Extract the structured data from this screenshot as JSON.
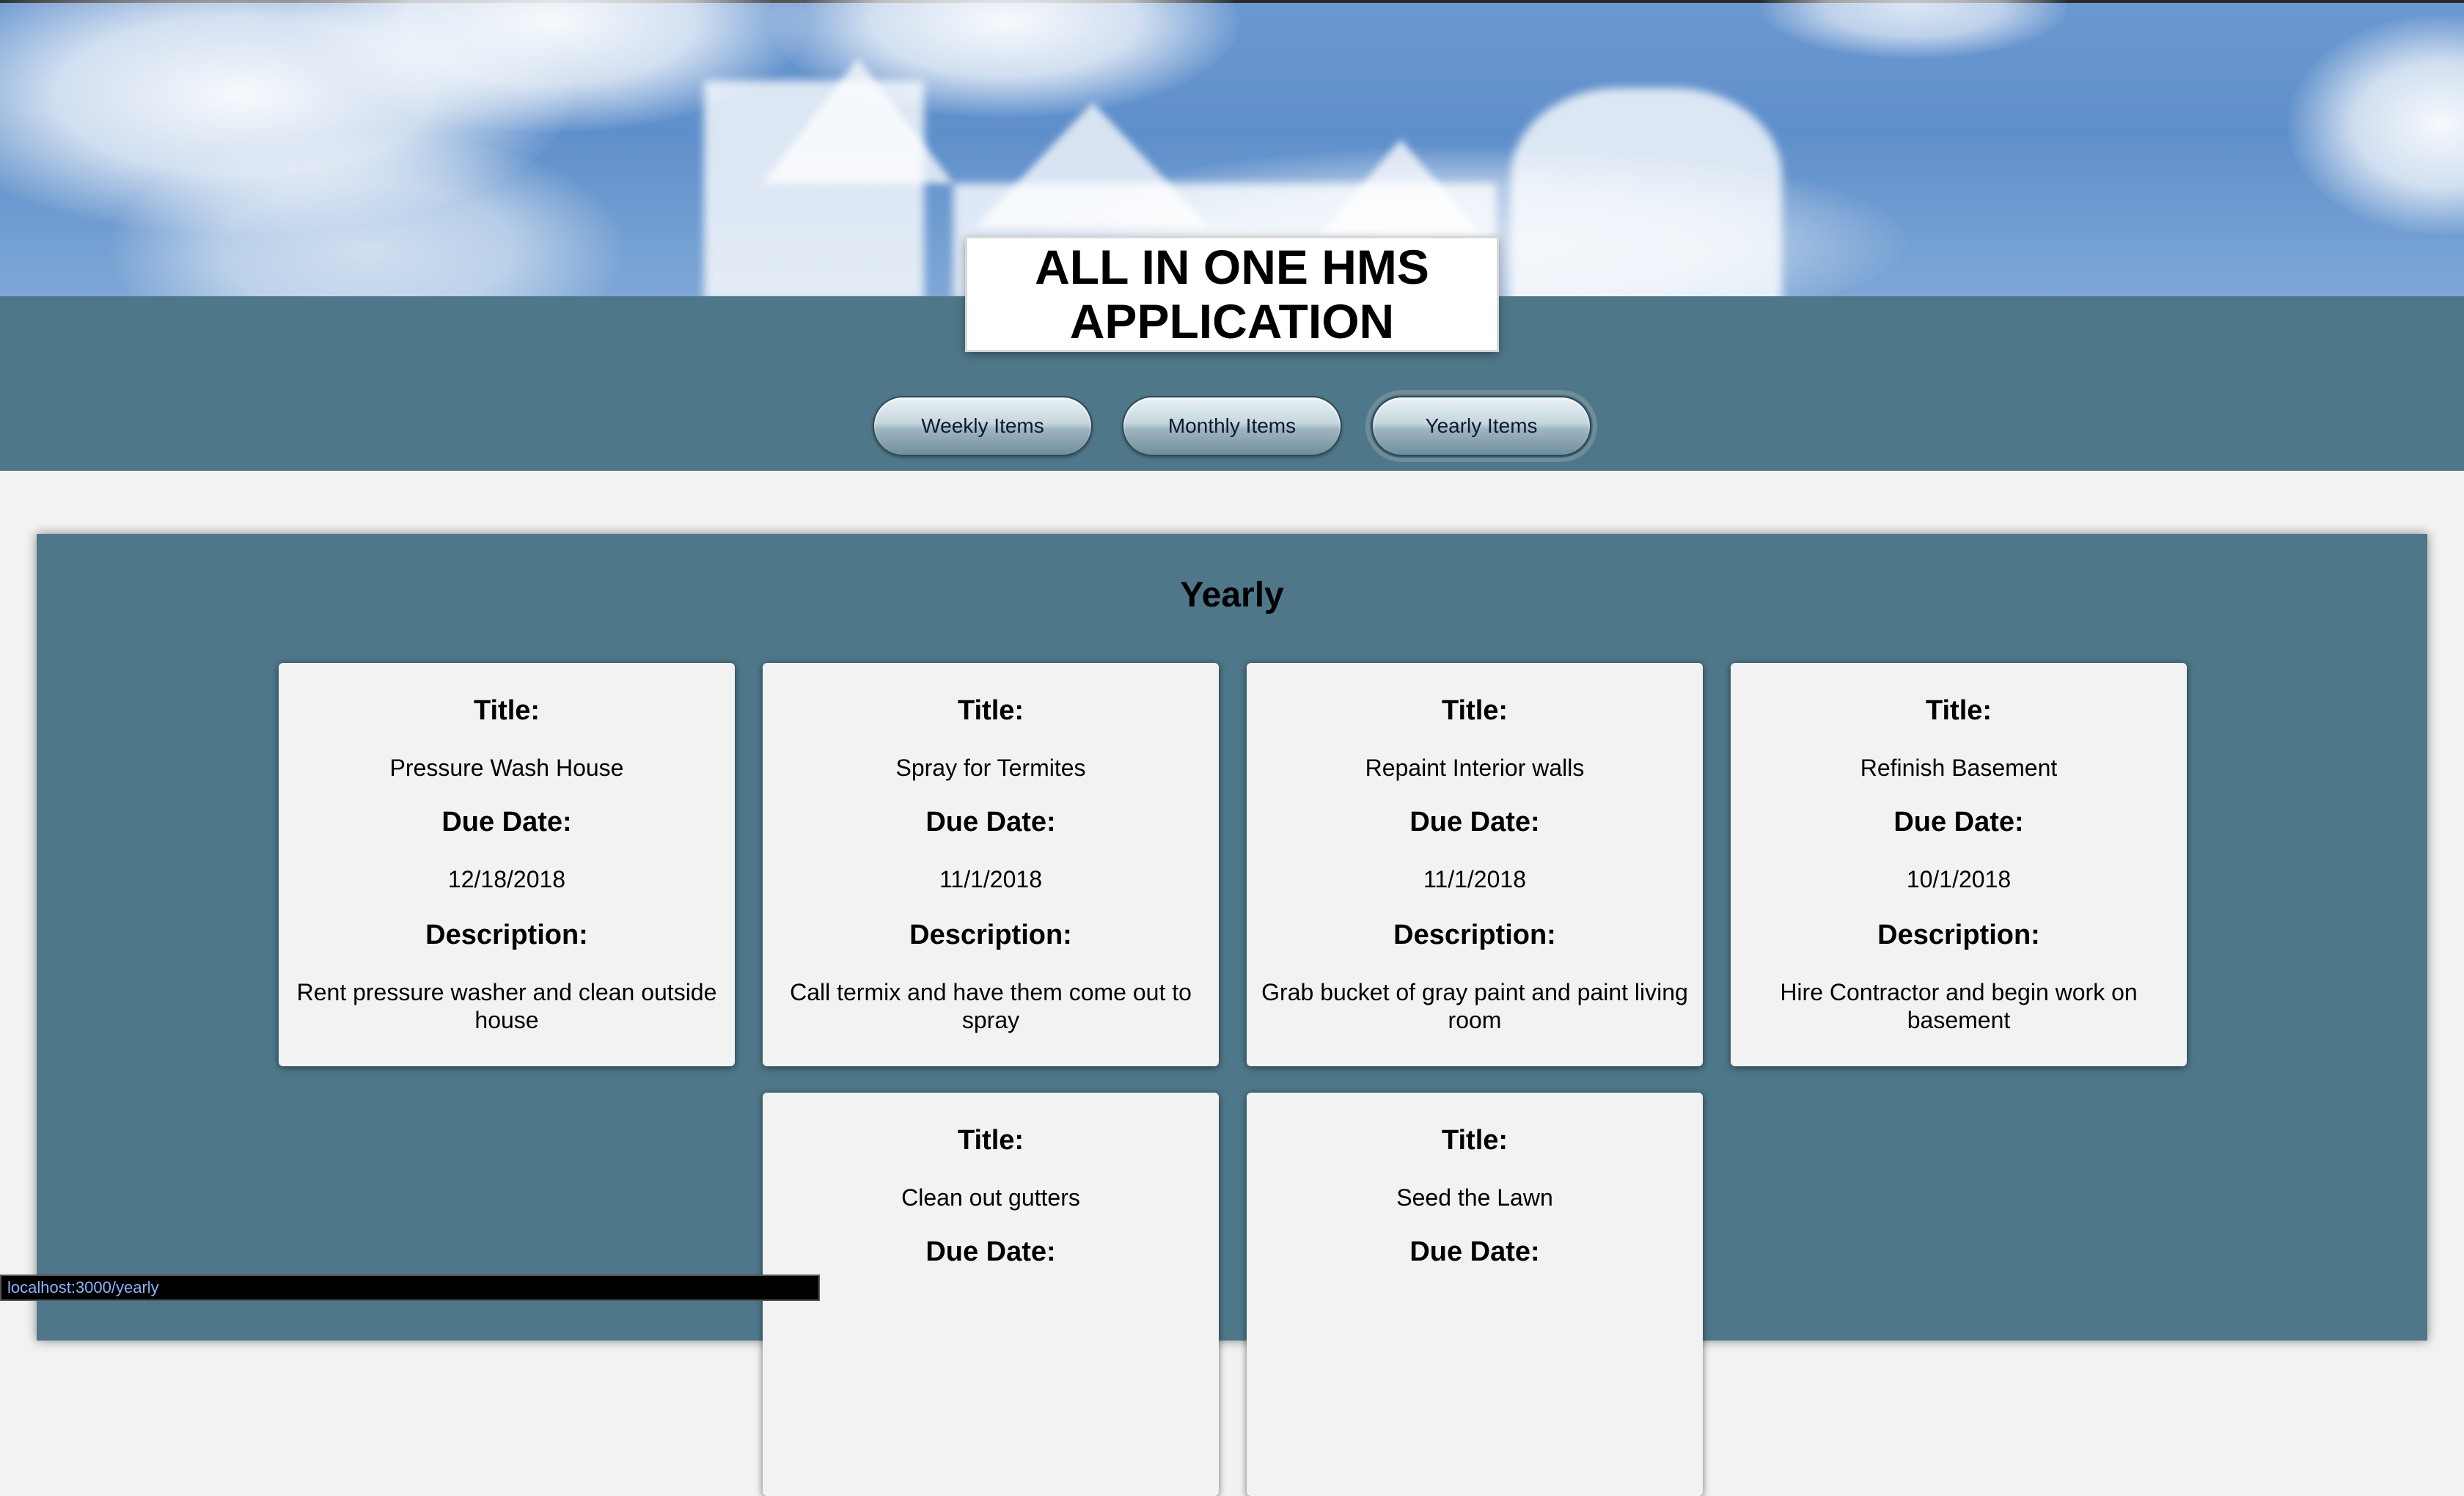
{
  "app": {
    "title": "ALL IN ONE HMS APPLICATION"
  },
  "nav": {
    "weekly_label": "Weekly Items",
    "monthly_label": "Monthly Items",
    "yearly_label": "Yearly Items",
    "active": "Yearly Items"
  },
  "section": {
    "heading": "Yearly"
  },
  "labels": {
    "title": "Title:",
    "due_date": "Due Date:",
    "description": "Description:"
  },
  "items": [
    {
      "title": "Pressure Wash House",
      "due": "12/18/2018",
      "description": "Rent pressure washer and clean outside house"
    },
    {
      "title": "Spray for Termites",
      "due": "11/1/2018",
      "description": "Call termix and have them come out to spray"
    },
    {
      "title": "Repaint Interior walls",
      "due": "11/1/2018",
      "description": "Grab bucket of gray paint and paint living room"
    },
    {
      "title": "Refinish Basement",
      "due": "10/1/2018",
      "description": "Hire Contractor and begin work on basement"
    },
    {
      "title": "Clean out gutters"
    },
    {
      "title": "Seed the Lawn"
    }
  ],
  "status_bar": {
    "url": "localhost:3000/yearly"
  },
  "colors": {
    "band": "#4e7889",
    "card": "#f2f2f2",
    "page_bg": "#f2f2f2"
  }
}
